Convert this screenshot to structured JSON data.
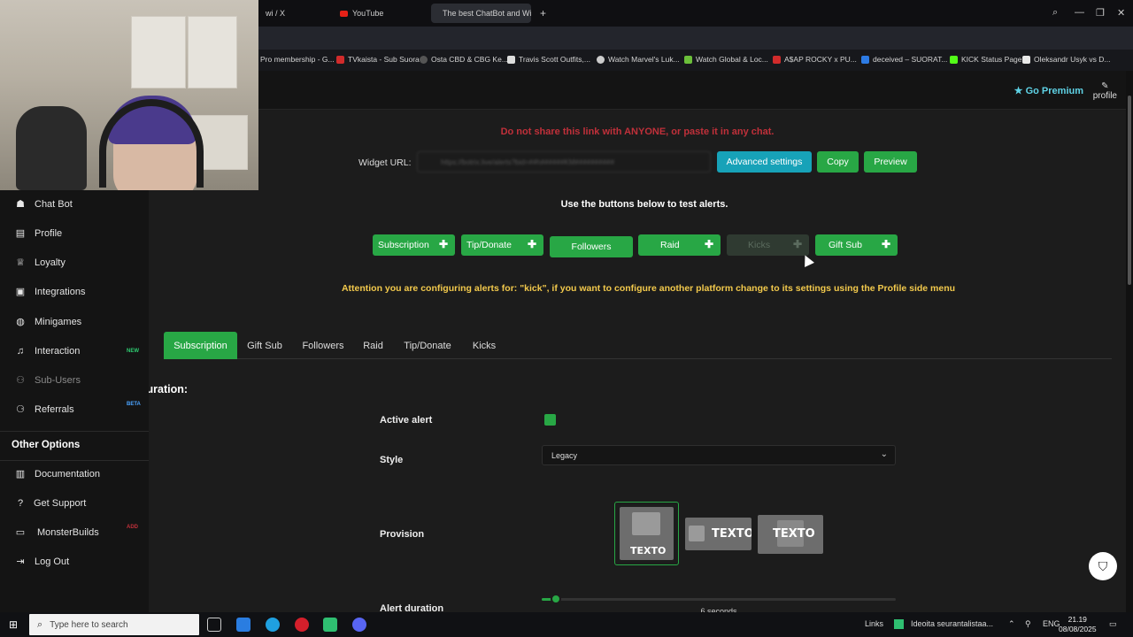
{
  "browser": {
    "tabs": [
      {
        "label": "wi / X",
        "active": false
      },
      {
        "label": "YouTube",
        "active": false
      },
      {
        "label": "The best ChatBot and Wi...",
        "active": true
      }
    ],
    "new_tab": "+",
    "bookmarks": [
      "Pro membership - G...",
      "TVkaista - Sub Suora",
      "Osta CBD & CBG Ke...",
      "Travis Scott Outfits,...",
      "Watch Marvel's Luk...",
      "Watch Global & Loc...",
      "A$AP ROCKY x PU...",
      "deceived – SUORAT...",
      "KICK Status Page",
      "Oleksandr Usyk vs D..."
    ]
  },
  "header": {
    "go_premium": "Go Premium",
    "profile": "profile"
  },
  "sidebar": {
    "items": [
      {
        "label": "Chat Bot",
        "icon": "robot-icon"
      },
      {
        "label": "Profile",
        "icon": "id-card-icon"
      },
      {
        "label": "Loyalty",
        "icon": "trophy-icon"
      },
      {
        "label": "Integrations",
        "icon": "plug-icon"
      },
      {
        "label": "Minigames",
        "icon": "gamepad-icon"
      },
      {
        "label": "Interaction",
        "icon": "music-note-icon",
        "badge": "NEW"
      },
      {
        "label": "Sub-Users",
        "icon": "users-icon"
      },
      {
        "label": "Referrals",
        "icon": "referral-icon",
        "badge": "BETA"
      }
    ],
    "other_options_title": "Other Options",
    "other_items": [
      {
        "label": "Documentation",
        "icon": "book-icon"
      },
      {
        "label": "Get Support",
        "icon": "question-icon"
      },
      {
        "label": "MonsterBuilds",
        "icon": "laptop-icon",
        "badge": "ADD"
      },
      {
        "label": "Log Out",
        "icon": "logout-icon"
      }
    ]
  },
  "main": {
    "warning": "Do not share this link with ANYONE, or paste it in any chat.",
    "widget_url_label": "Widget URL:",
    "widget_url_value": "https://botrix.live/alerts?bid=##h######KM##########",
    "buttons": {
      "advanced": "Advanced settings",
      "copy": "Copy",
      "preview": "Preview"
    },
    "test_title": "Use the buttons below to test alerts.",
    "test_buttons": [
      {
        "label": "Subscription",
        "has_plus": true,
        "disabled": false
      },
      {
        "label": "Tip/Donate",
        "has_plus": true,
        "disabled": false
      },
      {
        "label": "Followers",
        "has_plus": false,
        "disabled": false
      },
      {
        "label": "Raid",
        "has_plus": true,
        "disabled": false
      },
      {
        "label": "Kicks",
        "has_plus": true,
        "disabled": true
      },
      {
        "label": "Gift Sub",
        "has_plus": true,
        "disabled": false
      }
    ],
    "attention": "Attention you are configuring alerts for: \"kick\", if you want to configure another platform change to its settings using the Profile side menu",
    "alert_tabs": [
      "Subscription",
      "Gift Sub",
      "Followers",
      "Raid",
      "Tip/Donate",
      "Kicks"
    ],
    "active_tab": "Subscription",
    "config_title": "Configuration:",
    "fields": {
      "active_alert": "Active alert",
      "active_alert_checked": true,
      "style": "Style",
      "style_value": "Legacy",
      "provision": "Provision",
      "provision_text": "TEXTO",
      "alert_duration": "Alert duration",
      "alert_duration_value": "6 seconds",
      "alert_duration_fraction": 0.04
    }
  },
  "taskbar": {
    "search_placeholder": "Type here to search",
    "links": "Links",
    "notification": "Ideoita seurantalistaa...",
    "lang": "ENG",
    "time": "21.19",
    "date": "08/08/2025"
  },
  "colors": {
    "green": "#28a745",
    "teal": "#17a2b8",
    "warning_red": "#c0303a",
    "attention_yellow": "#f2c94c",
    "premium_cyan": "#5fd3e6"
  }
}
